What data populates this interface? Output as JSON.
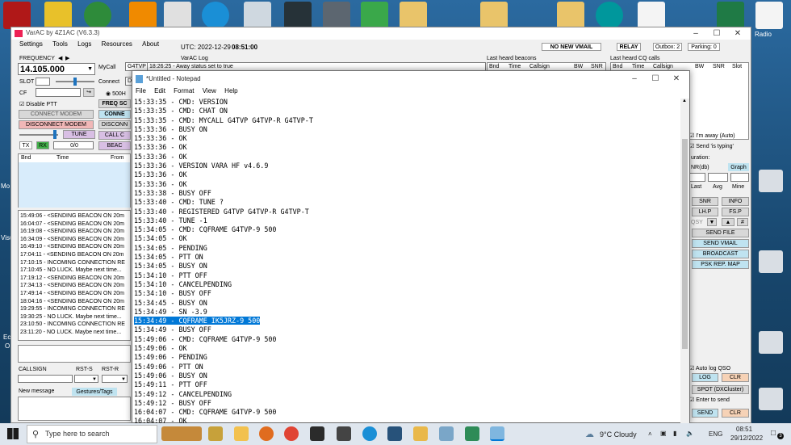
{
  "desktop": {
    "right_icon_label": "Radio",
    "left_edge_labels": [
      "Mo",
      "Visu",
      "Ec",
      "O"
    ]
  },
  "varac": {
    "title": "VarAC by 4Z1AC (V6.3.3)",
    "menu": [
      "Settings",
      "Tools",
      "Logs",
      "Resources",
      "About"
    ],
    "utc_label": "UTC: 2022-12-29",
    "utc_time": "08:51:00",
    "no_new_vmail": "NO NEW VMAIL",
    "relay": "RELAY",
    "outbox": "Outbox: 2",
    "parking": "Parking: 0",
    "frequency_label": "FREQUENCY",
    "frequency_value": "14.105.000",
    "mycall_label": "MyCall",
    "mycall_value": "G4TVP",
    "slot_label": "SLOT",
    "connect_label": "Connect",
    "connect_value": "D",
    "cf_label": "CF",
    "bw_500": "500H",
    "disable_ptt": "Disable PTT",
    "connect_modem": "CONNECT MODEM",
    "disconnect_modem": "DISCONNECT MODEM",
    "tune": "TUNE",
    "tx": "TX",
    "rx": "RX",
    "ratio": "0/0",
    "freq_sc": "FREQ SC",
    "conne": "CONNE",
    "disconn": "DISCONN",
    "call_c": "CALL C",
    "beac": "BEAC",
    "grid_headers": [
      "Bnd",
      "Time",
      "From"
    ],
    "varac_log_label": "VarAC Log",
    "varac_log_entry": "18:26:25 - Away status set to true",
    "last_heard_beacons": "Last heard beacons",
    "beacons_headers": [
      "Bnd",
      "Time",
      "Callsign",
      "BW",
      "SNR"
    ],
    "last_heard_cq": "Last heard CQ calls",
    "cq_headers": [
      "Bnd",
      "Time",
      "Callsign",
      "BW",
      "SNR",
      "Slot"
    ],
    "beacon_log": [
      "15:49:06 -  <SENDING BEACON ON 20m",
      "16:04:07 -  <SENDING BEACON ON 20m",
      "16:19:08 -  <SENDING BEACON ON 20m",
      "16:34:09 -  <SENDING BEACON ON 20m",
      "16:49:10 -  <SENDING BEACON ON 20m",
      "17:04:11 -  <SENDING BEACON ON 20m",
      "17:10:15 - INCOMING CONNECTION RE",
      "17:10:45 - NO LUCK. Maybe next time...",
      "17:19:12 -  <SENDING BEACON ON 20m",
      "17:34:13 -  <SENDING BEACON ON 20m",
      "17:49:14 -  <SENDING BEACON ON 20m",
      "18:04:16 -  <SENDING BEACON ON 20m",
      "19:29:55 - INCOMING CONNECTION RE",
      "19:30:25 - NO LUCK. Maybe next time...",
      "23:10:50 - INCOMING CONNECTION RE",
      "23:11:20 - NO LUCK. Maybe next time..."
    ],
    "callsign_label": "CALLSIGN",
    "rst_s_label": "RST-S",
    "rst_r_label": "RST-R",
    "new_message_label": "New message",
    "gestures_tags": "Gestures/Tags",
    "right_panel": {
      "away": "I'm away (Auto)",
      "send_typing": "Send 'is typing'",
      "duration": "uration:",
      "snr_db": "NR(db)",
      "graph": "Graph",
      "last": "Last",
      "avg": "Avg",
      "mine": "Mine",
      "snr_btn": "SNR",
      "info_btn": "INFO",
      "lhp_btn": "LH.P",
      "fsp_btn": "FS.P",
      "qsy": "QSY",
      "hash": "#",
      "send_file": "SEND FILE",
      "send_vmail": "SEND VMAIL",
      "broadcast": "BROADCAST",
      "psk_map": "PSK REP. MAP",
      "auto_log": "Auto log QSO",
      "log_btn": "LOG",
      "clr_btn": "CLR",
      "spot": "SPOT (DXCluster)",
      "enter_send": "Enter to send",
      "send_btn": "SEND",
      "clr_btn2": "CLR"
    }
  },
  "notepad": {
    "title": "*Untitled - Notepad",
    "menu": [
      "File",
      "Edit",
      "Format",
      "View",
      "Help"
    ],
    "lines": [
      "15:33:35 - CMD: VERSION",
      "15:33:35 - CMD: CHAT ON",
      "15:33:35 - CMD: MYCALL G4TVP G4TVP-R G4TVP-T",
      "15:33:36 - BUSY ON",
      "15:33:36 - OK",
      "15:33:36 - OK",
      "15:33:36 - OK",
      "15:33:36 - VERSION VARA HF v4.6.9",
      "15:33:36 - OK",
      "15:33:36 - OK",
      "15:33:38 - BUSY OFF",
      "15:33:40 - CMD: TUNE ?",
      "15:33:40 - REGISTERED G4TVP G4TVP-R G4TVP-T",
      "15:33:40 - TUNE -1",
      "15:34:05 - CMD: CQFRAME G4TVP-9 500",
      "15:34:05 - OK",
      "15:34:05 - PENDING",
      "15:34:05 - PTT ON",
      "15:34:05 - BUSY ON",
      "15:34:10 - PTT OFF",
      "15:34:10 - CANCELPENDING",
      "15:34:10 - BUSY OFF",
      "15:34:45 - BUSY ON",
      "15:34:49 - SN -3.9",
      "15:34:49 - CQFRAME IK5JRZ-9 500",
      "15:34:49 - BUSY OFF",
      "15:49:06 - CMD: CQFRAME G4TVP-9 500",
      "15:49:06 - OK",
      "15:49:06 - PENDING",
      "15:49:06 - PTT ON",
      "15:49:06 - BUSY ON",
      "15:49:11 - PTT OFF",
      "15:49:12 - CANCELPENDING",
      "15:49:12 - BUSY OFF",
      "16:04:07 - CMD: CQFRAME G4TVP-9 500",
      "16:04:07 - OK"
    ],
    "selected_line_index": 24
  },
  "taskbar": {
    "search_placeholder": "Type here to search",
    "weather": "9°C  Cloudy",
    "lang": "ENG",
    "time": "08:51",
    "date": "29/12/2022",
    "notif_count": "3"
  }
}
